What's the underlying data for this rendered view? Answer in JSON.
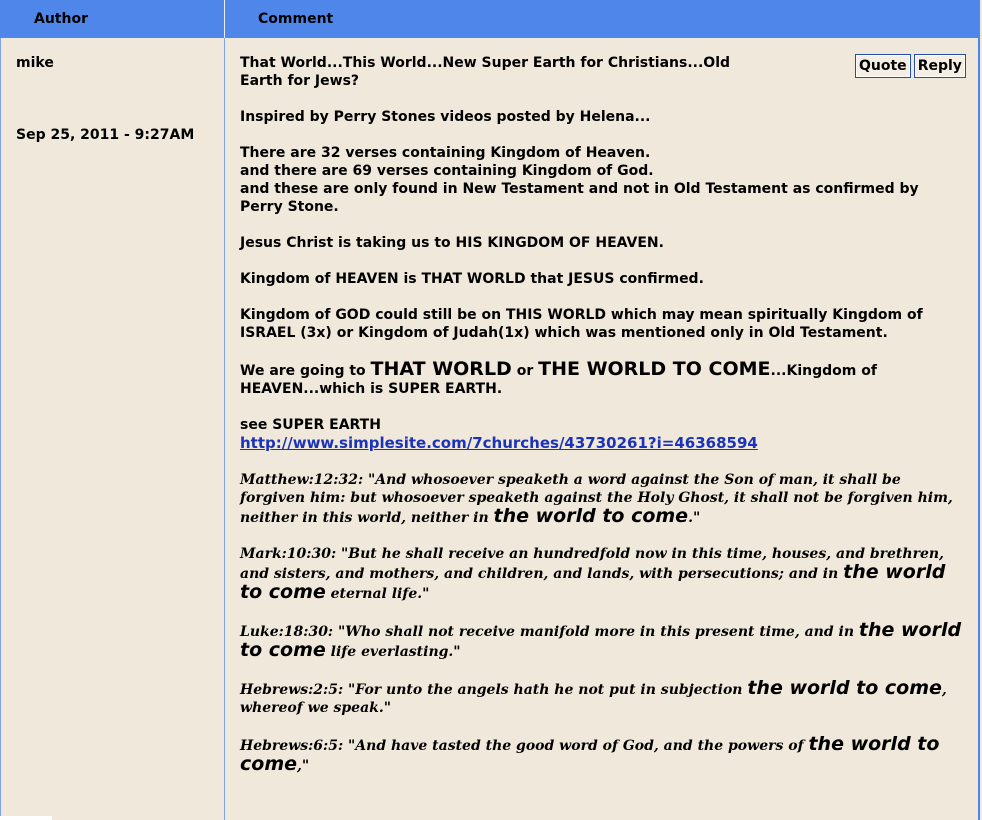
{
  "header": {
    "author_label": "Author",
    "comment_label": "Comment"
  },
  "post": {
    "author": "mike",
    "date": "Sep 25, 2011 - 9:27AM",
    "buttons": {
      "quote": "Quote",
      "reply": "Reply"
    },
    "title": "That World...This World...New Super Earth for Christians...Old Earth for Jews?",
    "inspired": "Inspired by Perry Stones videos posted by Helena...",
    "verses_count_1": "There are 32 verses containing Kingdom of Heaven.",
    "verses_count_2": "and there are 69 verses containing Kingdom of God.",
    "verses_count_3": "and these are only found in New Testament and not in Old Testament as confirmed by Perry Stone.",
    "jesus_line": "Jesus Christ is taking us to HIS KINGDOM OF HEAVEN.",
    "heaven_line": "Kingdom of HEAVEN is THAT WORLD that JESUS confirmed.",
    "god_line": "Kingdom of GOD could still be on THIS WORLD which may mean spiritually Kingdom of ISRAEL (3x) or Kingdom of Judah(1x) which was mentioned only in Old Testament.",
    "going_1": "We are going to ",
    "going_big_1": "THAT WORLD",
    "going_2": " or ",
    "going_big_2": "THE WORLD TO COME",
    "going_3": "...Kingdom of HEAVEN...which is SUPER EARTH.",
    "see": "see SUPER EARTH",
    "link": "http://www.simplesite.com/7churches/43730261?i=46368594",
    "verses": [
      {
        "pre": "Matthew:12:32: \"And whosoever speaketh a word against the Son of man, it shall be forgiven him: but whosoever speaketh against the Holy Ghost, it shall not be forgiven him, neither in this world, neither in ",
        "big": "the world to come",
        "post": ".\""
      },
      {
        "pre": "Mark:10:30: \"But he shall receive an hundredfold now in this time, houses, and brethren, and sisters, and mothers, and children, and lands, with persecutions; and in ",
        "big": "the world to come",
        "post": " eternal life.\""
      },
      {
        "pre": "Luke:18:30: \"Who shall not receive manifold more in this present time, and in ",
        "big": "the world to come",
        "post": " life everlasting.\""
      },
      {
        "pre": "Hebrews:2:5: \"For unto the angels hath he not put in subjection ",
        "big": "the world to come",
        "post": ", whereof we speak.\""
      },
      {
        "pre": "Hebrews:6:5: \"And have tasted the good word of God, and the powers of ",
        "big": "the world to come",
        "post": ",\""
      }
    ]
  },
  "colors": {
    "header_bg": "#4f86ea",
    "page_bg": "#f0e8db",
    "link": "#1a33b8"
  }
}
